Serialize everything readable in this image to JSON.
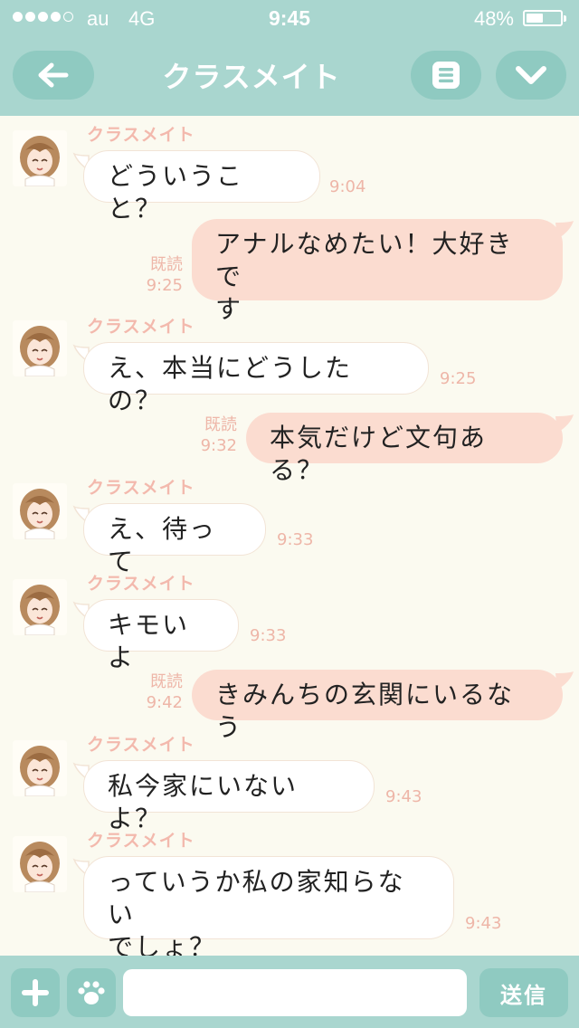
{
  "status_bar": {
    "carrier": "au",
    "network": "4G",
    "time": "9:45",
    "battery_text": "48%",
    "battery_level": 0.48,
    "signal_bars_filled": 4,
    "signal_bars_total": 5
  },
  "header": {
    "title": "クラスメイト",
    "back_icon": "arrow-left-icon",
    "menu_icon": "menu-list-icon",
    "dropdown_icon": "chevron-down-icon"
  },
  "messages": [
    {
      "sender": "クラスメイト",
      "line1": "どういうこと？",
      "time": "9:04"
    },
    {
      "line1": "アナルなめたい！大好きで",
      "line2": "す",
      "read": "既読",
      "time": "9:25"
    },
    {
      "sender": "クラスメイト",
      "line1": "え、本当にどうしたの？",
      "time": "9:25"
    },
    {
      "line1": "本気だけど文句ある？",
      "read": "既読",
      "time": "9:32"
    },
    {
      "sender": "クラスメイト",
      "line1": "え、待って",
      "time": "9:33"
    },
    {
      "sender": "クラスメイト",
      "line1": "キモいよ",
      "time": "9:33"
    },
    {
      "line1": "きみんちの玄関にいるなう",
      "read": "既読",
      "time": "9:42"
    },
    {
      "sender": "クラスメイト",
      "line1": "私今家にいないよ？",
      "time": "9:43"
    },
    {
      "sender": "クラスメイト",
      "line1": "っていうか私の家知らない",
      "line2": "でしょ？",
      "time": "9:43"
    }
  ],
  "input_bar": {
    "placeholder": "",
    "send_label": "送信",
    "plus_icon": "plus-icon",
    "stamp_icon": "paw-icon"
  },
  "colors": {
    "header": "#a9d6cf",
    "header_button": "#8fcac1",
    "chat_background": "#fbfaf0",
    "incoming_bubble": "#ffffff",
    "outgoing_bubble": "#fbdcd0",
    "accent_text": "#f3b9ad"
  }
}
